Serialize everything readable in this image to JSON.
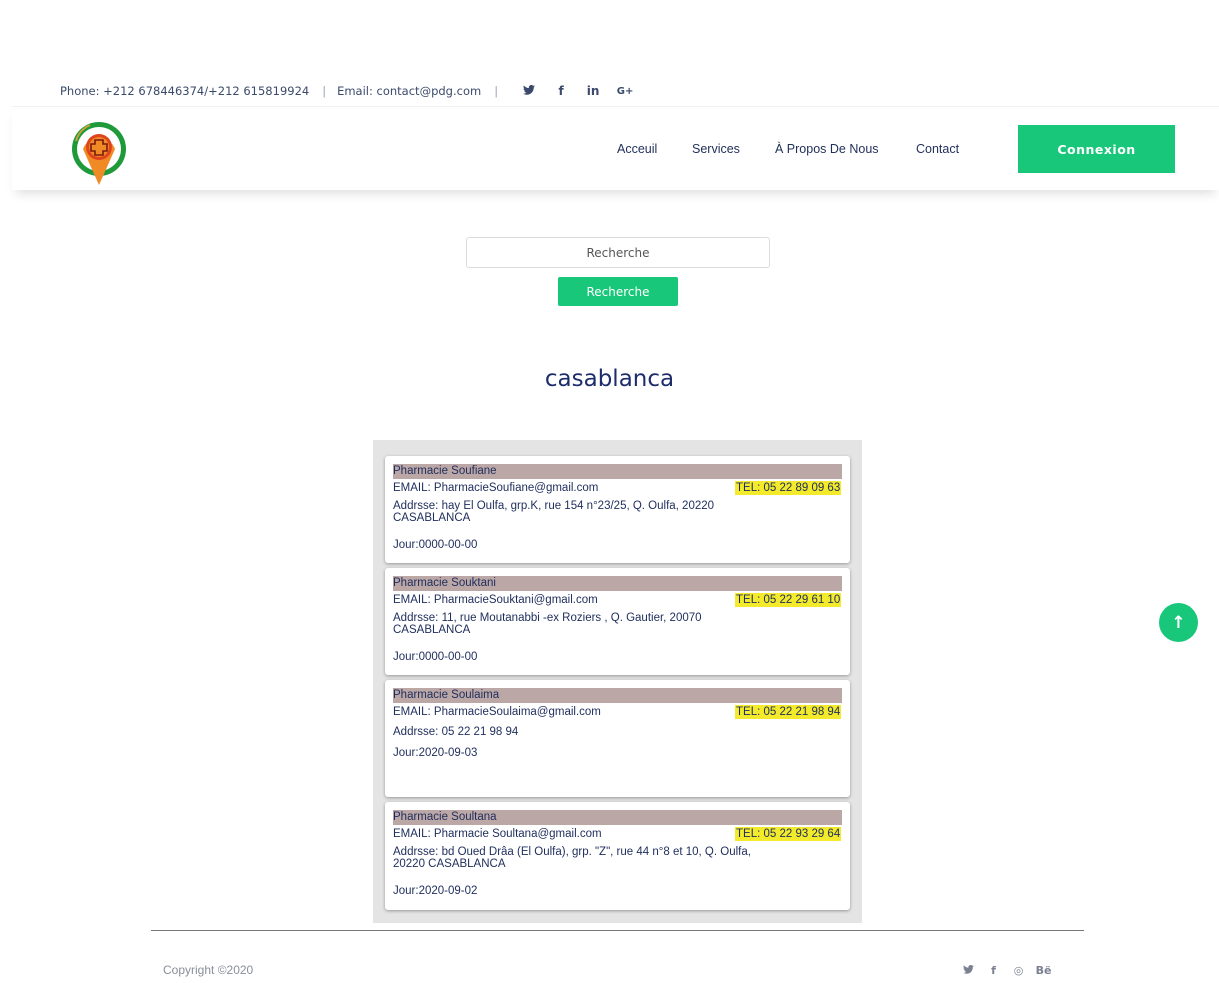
{
  "topbar": {
    "phone": "Phone: +212 678446374/+212 615819924",
    "separator": "|",
    "email": "Email: contact@pdg.com",
    "social_icons": [
      "twitter-icon",
      "facebook-icon",
      "linkedin-icon",
      "google-plus-icon"
    ],
    "social_glyphs": [
      "♥",
      "f",
      "in",
      "G+"
    ]
  },
  "header": {
    "logo_icon": "pharmacy-location-pin-icon",
    "nav": [
      {
        "label": "Acceuil"
      },
      {
        "label": "Services"
      },
      {
        "label": "À Propos De Nous"
      },
      {
        "label": "Contact"
      }
    ],
    "connexion_label": "Connexion"
  },
  "search": {
    "placeholder": "Recherche",
    "button_label": "Recherche"
  },
  "city_title": "casablanca",
  "pharmacies": [
    {
      "name": "Pharmacie Soufiane",
      "email": "EMAIL: PharmacieSoufiane@gmail.com",
      "tel": "TEL: 05 22 89 09 63",
      "address": "Addrsse: hay El Oulfa, grp.K, rue 154 n°23/25, Q. Oulfa, 20220 CASABLANCA",
      "jour": "Jour:0000-00-00"
    },
    {
      "name": "Pharmacie Souktani",
      "email": "EMAIL: PharmacieSouktani@gmail.com",
      "tel": "TEL: 05 22 29 61 10",
      "address": "Addrsse: 11, rue Moutanabbi -ex Roziers , Q. Gautier, 20070 CASABLANCA",
      "jour": "Jour:0000-00-00"
    },
    {
      "name": "Pharmacie Soulaima",
      "email": "EMAIL: PharmacieSoulaima@gmail.com",
      "tel": "TEL: 05 22 21 98 94",
      "address": "Addrsse: 05 22 21 98 94",
      "jour": "Jour:2020-09-03"
    },
    {
      "name": "Pharmacie Soultana",
      "email": "EMAIL: Pharmacie Soultana@gmail.com",
      "tel": "TEL: 05 22 93 29 64",
      "address": "Addrsse: bd Oued Drâa (El Oulfa), grp. \"Z\", rue 44 n°8 et 10, Q. Oulfa, 20220 CASABLANCA",
      "jour": "Jour:2020-09-02"
    }
  ],
  "footer": {
    "copyright": "Copyright ©2020",
    "social_icons": [
      "twitter-icon",
      "facebook-icon",
      "dribbble-icon",
      "behance-icon"
    ],
    "social_glyphs": [
      "♥",
      "f",
      "◎",
      "Bë"
    ]
  },
  "scroll_top_icon": "arrow-up-icon",
  "colors": {
    "accent_green": "#19c77a",
    "navy_text": "#1d2d6b",
    "name_highlight": "#bca7a7",
    "tel_highlight": "#f2ea2a"
  }
}
